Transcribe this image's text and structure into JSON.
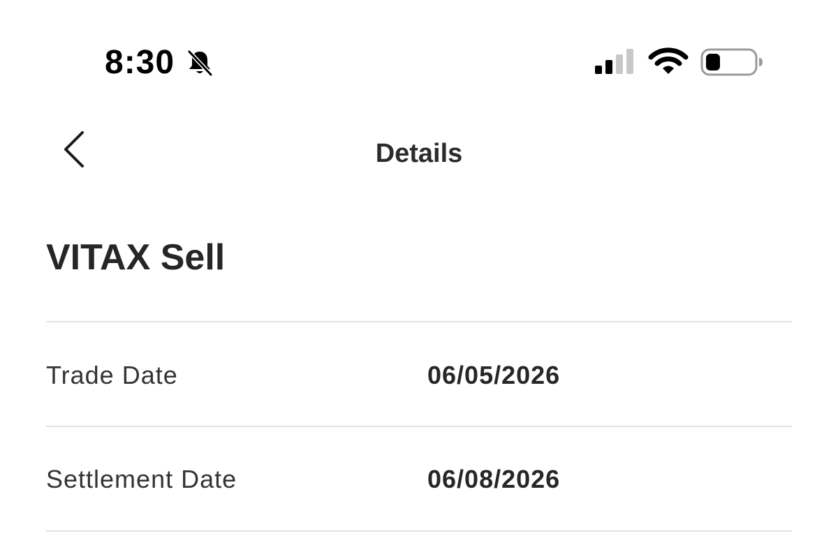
{
  "status_bar": {
    "time": "8:30",
    "silent_icon": "bell-slash-icon",
    "signal_icon": "cellular-signal-icon",
    "wifi_icon": "wifi-icon",
    "battery_icon": "battery-icon",
    "signal_bars_active": 2,
    "signal_bars_total": 4,
    "battery_level": 0.3
  },
  "nav": {
    "back_icon": "chevron-left-icon",
    "title": "Details"
  },
  "transaction": {
    "title": "VITAX Sell",
    "rows": [
      {
        "label": "Trade Date",
        "value": "06/05/2026"
      },
      {
        "label": "Settlement Date",
        "value": "06/08/2026"
      }
    ]
  },
  "colors": {
    "text": "#222222",
    "divider": "#e2e2e2",
    "background": "#ffffff"
  }
}
